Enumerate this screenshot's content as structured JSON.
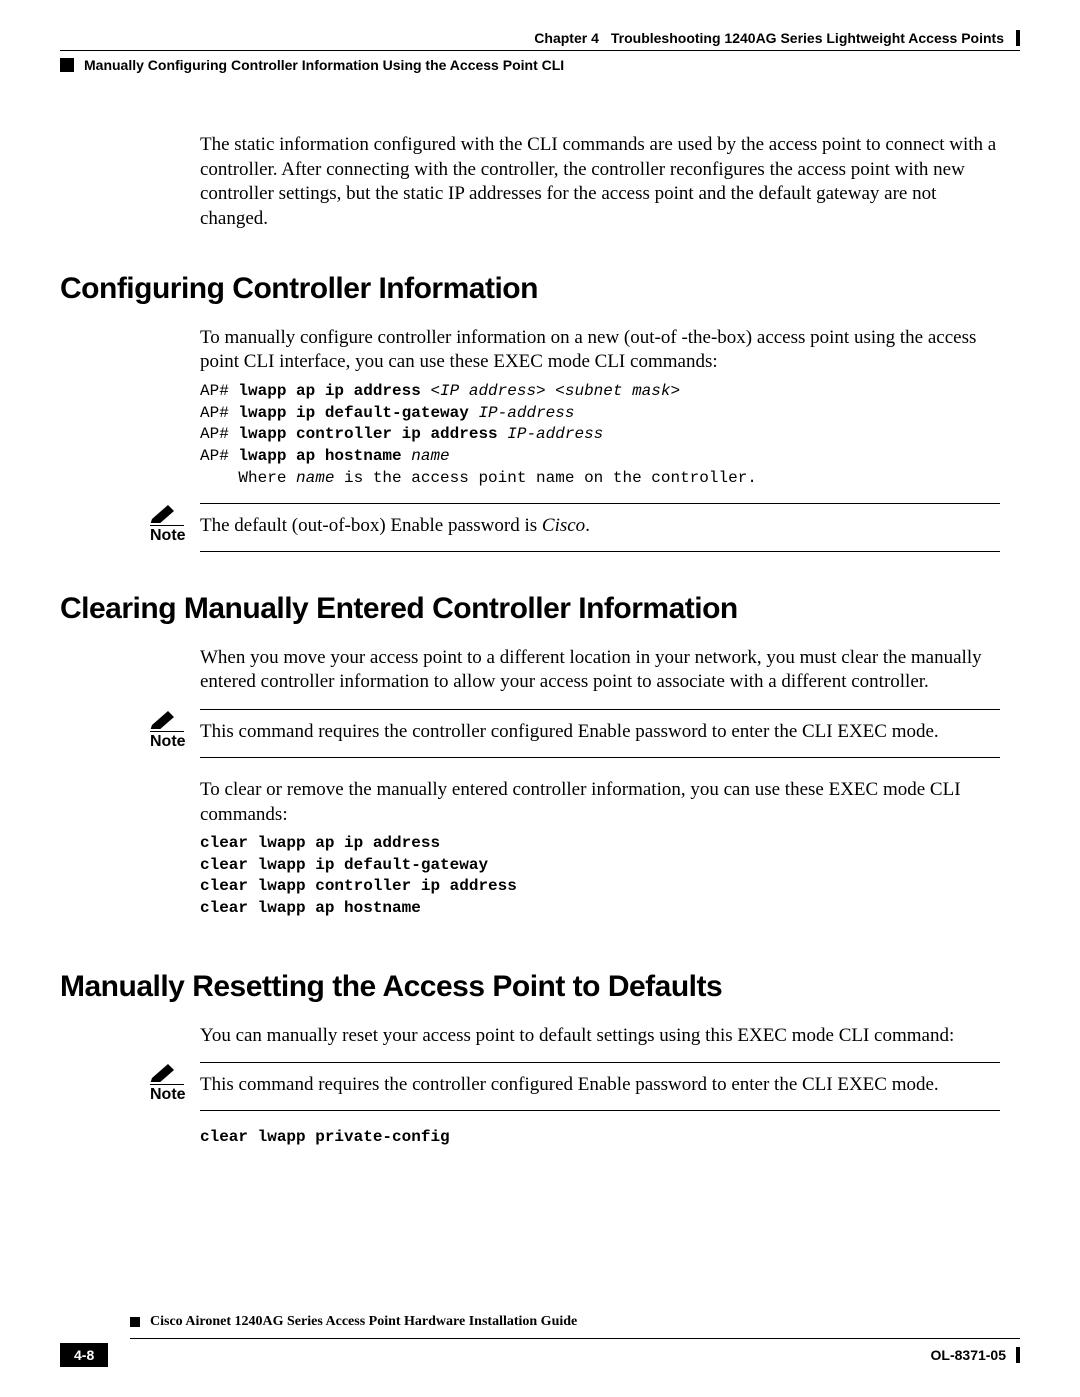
{
  "header": {
    "chapter_label": "Chapter 4",
    "chapter_title": "Troubleshooting 1240AG Series Lightweight Access Points",
    "subhead": "Manually Configuring Controller Information Using the Access Point CLI"
  },
  "intro_para": "The static information configured with the CLI commands are used by the access point to connect with a controller. After connecting with the controller, the controller reconfigures the access point with new controller settings, but the static IP addresses for the access point and the default gateway are not changed.",
  "section1": {
    "heading": "Configuring Controller Information",
    "para": "To manually configure controller information on a new (out-of -the-box) access point using the access point CLI interface, you can use these EXEC mode CLI commands:",
    "code": {
      "l1p": "AP# ",
      "l1b": "lwapp ap ip address ",
      "l1i": "<IP address> <subnet mask>",
      "l2p": "AP# ",
      "l2b": "lwapp ip default-gateway ",
      "l2i": "IP-address",
      "l3p": "AP# ",
      "l3b": "lwapp controller ip address ",
      "l3i": "IP-address",
      "l4p": "AP# ",
      "l4b": "lwapp ap hostname ",
      "l4i": "name",
      "l5a": "    Where ",
      "l5i": "name",
      "l5b": " is the access point name on the controller."
    },
    "note_label": "Note",
    "note_a": "The default (out-of-box) Enable password is ",
    "note_i": "Cisco",
    "note_b": "."
  },
  "section2": {
    "heading": "Clearing Manually Entered Controller Information",
    "para1": "When you move your access point to a different location in your network, you must clear the manually entered controller information to allow your access point to associate with a different controller.",
    "note_label": "Note",
    "note_text": "This command requires the controller configured Enable password to enter the CLI EXEC mode.",
    "para2": "To clear or remove the manually entered controller information, you can use these EXEC mode CLI commands:",
    "code": "clear lwapp ap ip address\nclear lwapp ip default-gateway\nclear lwapp controller ip address\nclear lwapp ap hostname"
  },
  "section3": {
    "heading": "Manually Resetting the Access Point to Defaults",
    "para": "You can manually reset your access point to default settings using this EXEC mode CLI command:",
    "note_label": "Note",
    "note_text": "This command requires the controller configured Enable password to enter the CLI EXEC mode.",
    "code": "clear lwapp private-config"
  },
  "footer": {
    "guide": "Cisco Aironet 1240AG Series Access Point Hardware Installation Guide",
    "page": "4-8",
    "docnum": "OL-8371-05"
  }
}
